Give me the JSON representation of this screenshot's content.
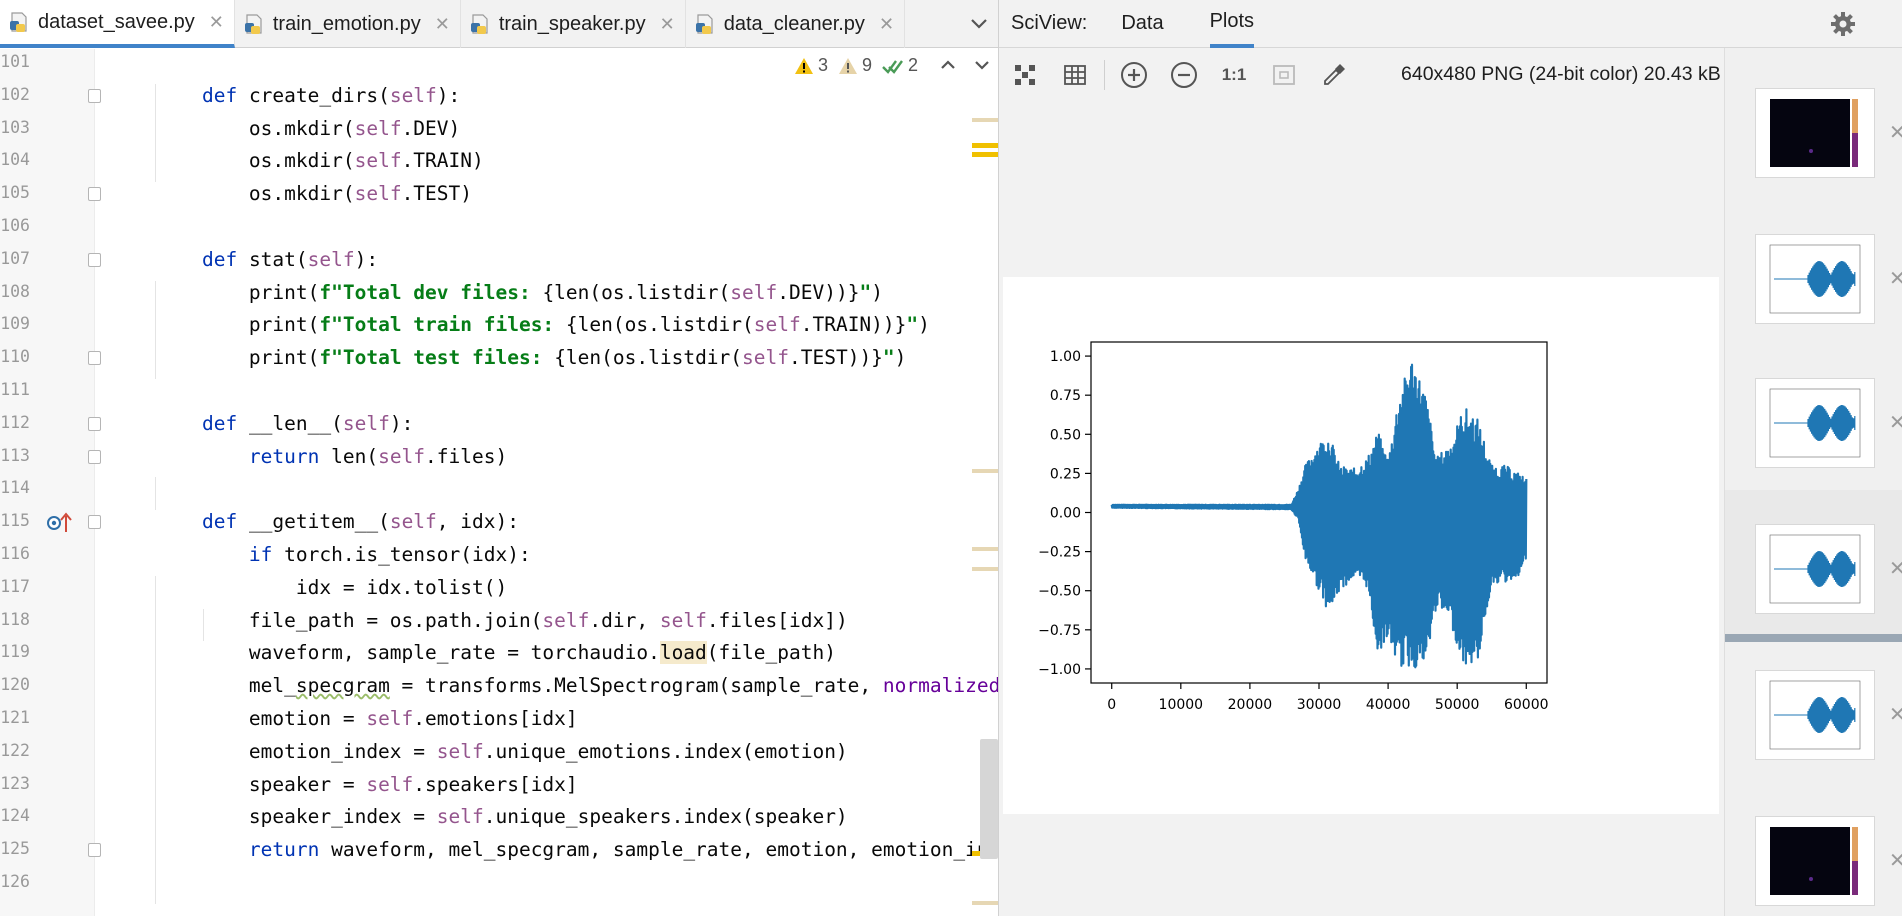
{
  "tabs": [
    {
      "label": "dataset_savee.py",
      "active": true
    },
    {
      "label": "train_emotion.py",
      "active": false
    },
    {
      "label": "train_speaker.py",
      "active": false
    },
    {
      "label": "data_cleaner.py",
      "active": false
    }
  ],
  "inspections": {
    "errors": "3",
    "warnings": "9",
    "typos": "2"
  },
  "code": [
    {
      "n": "101",
      "html": ""
    },
    {
      "n": "102",
      "html": "    <span class='kw'>def</span> create_dirs(<span class='slf'>self</span>):"
    },
    {
      "n": "103",
      "html": "        os.mkdir(<span class='slf'>self</span>.DEV)"
    },
    {
      "n": "104",
      "html": "        os.mkdir(<span class='slf'>self</span>.TRAIN)"
    },
    {
      "n": "105",
      "html": "        os.mkdir(<span class='slf'>self</span>.TEST)"
    },
    {
      "n": "106",
      "html": ""
    },
    {
      "n": "107",
      "html": "    <span class='kw'>def</span> stat(<span class='slf'>self</span>):"
    },
    {
      "n": "108",
      "html": "        print(<span class='str'>f\"Total dev files: </span>{len(os.listdir(<span class='slf'>self</span>.DEV))}<span class='str'>\"</span>)"
    },
    {
      "n": "109",
      "html": "        print(<span class='str'>f\"Total train files: </span>{len(os.listdir(<span class='slf'>self</span>.TRAIN))}<span class='str'>\"</span>)"
    },
    {
      "n": "110",
      "html": "        print(<span class='str'>f\"Total test files: </span>{len(os.listdir(<span class='slf'>self</span>.TEST))}<span class='str'>\"</span>)"
    },
    {
      "n": "111",
      "html": ""
    },
    {
      "n": "112",
      "html": "    <span class='kw'>def</span> __len__(<span class='slf'>self</span>):"
    },
    {
      "n": "113",
      "html": "        <span class='kw'>return</span> len(<span class='slf'>self</span>.files)"
    },
    {
      "n": "114",
      "html": ""
    },
    {
      "n": "115",
      "html": "    <span class='kw'>def</span> __getitem__(<span class='slf'>self</span>, idx):"
    },
    {
      "n": "116",
      "html": "        <span class='kw'>if</span> torch.is_tensor(idx):"
    },
    {
      "n": "117",
      "html": "            idx = idx.tolist()"
    },
    {
      "n": "118",
      "html": "        file_path = os.path.join(<span class='slf'>self</span>.dir, <span class='slf'>self</span>.files[idx])"
    },
    {
      "n": "119",
      "html": "        waveform, sample_rate = torchaudio.<span class='hl'>load</span>(file_path)"
    },
    {
      "n": "120",
      "html": "        mel_<span class='warn-ul'>specgram</span> = transforms.MelSpectrogram(sample_rate, <span class='param'>normalized</span>=True)"
    },
    {
      "n": "121",
      "html": "        emotion = <span class='slf'>self</span>.emotions[idx]"
    },
    {
      "n": "122",
      "html": "        emotion_index = <span class='slf'>self</span>.unique_emotions.index(emotion)"
    },
    {
      "n": "123",
      "html": "        speaker = <span class='slf'>self</span>.speakers[idx]"
    },
    {
      "n": "124",
      "html": "        speaker_index = <span class='slf'>self</span>.unique_speakers.index(speaker)"
    },
    {
      "n": "125",
      "html": "        <span class='kw'>return</span> waveform, mel_specgram, sample_rate, emotion, emotion_index"
    },
    {
      "n": "126",
      "html": ""
    }
  ],
  "sciview": {
    "title": "SciView:",
    "tabs": [
      {
        "label": "Data",
        "active": false
      },
      {
        "label": "Plots",
        "active": true
      }
    ],
    "zoom_actual": "1:1",
    "image_info": "640x480 PNG (24-bit color) 20.43 kB"
  },
  "chart_data": {
    "type": "line",
    "title": "",
    "xlabel": "",
    "ylabel": "",
    "xlim": [
      -3000,
      63000
    ],
    "ylim": [
      -1.09,
      1.09
    ],
    "xticks": [
      "0",
      "10000",
      "20000",
      "30000",
      "40000",
      "50000",
      "60000"
    ],
    "yticks": [
      "1.00",
      "0.75",
      "0.50",
      "0.25",
      "0.00",
      "−0.25",
      "−0.50",
      "−0.75",
      "−1.00"
    ],
    "series": [
      {
        "color": "#1f77b4",
        "description_points": [
          {
            "x": 0,
            "y_max": 0.05,
            "y_min": 0.03
          },
          {
            "x": 26000,
            "y_max": 0.05,
            "y_min": 0.02
          },
          {
            "x": 27000,
            "y_max": 0.15,
            "y_min": -0.05
          },
          {
            "x": 28000,
            "y_max": 0.3,
            "y_min": -0.3
          },
          {
            "x": 30000,
            "y_max": 0.45,
            "y_min": -0.5
          },
          {
            "x": 31500,
            "y_max": 0.5,
            "y_min": -0.65
          },
          {
            "x": 33000,
            "y_max": 0.3,
            "y_min": -0.5
          },
          {
            "x": 35000,
            "y_max": 0.28,
            "y_min": -0.42
          },
          {
            "x": 37000,
            "y_max": 0.35,
            "y_min": -0.48
          },
          {
            "x": 38500,
            "y_max": 0.52,
            "y_min": -0.9
          },
          {
            "x": 40000,
            "y_max": 0.35,
            "y_min": -0.8
          },
          {
            "x": 41500,
            "y_max": 0.75,
            "y_min": -0.99
          },
          {
            "x": 43500,
            "y_max": 1.0,
            "y_min": -1.0
          },
          {
            "x": 45500,
            "y_max": 0.75,
            "y_min": -0.99
          },
          {
            "x": 47000,
            "y_max": 0.35,
            "y_min": -0.6
          },
          {
            "x": 49000,
            "y_max": 0.45,
            "y_min": -0.7
          },
          {
            "x": 51000,
            "y_max": 0.68,
            "y_min": -0.99
          },
          {
            "x": 53000,
            "y_max": 0.6,
            "y_min": -0.95
          },
          {
            "x": 55000,
            "y_max": 0.3,
            "y_min": -0.45
          },
          {
            "x": 57000,
            "y_max": 0.3,
            "y_min": -0.45
          },
          {
            "x": 59000,
            "y_max": 0.25,
            "y_min": -0.4
          },
          {
            "x": 60000,
            "y_max": 0.22,
            "y_min": -0.3
          }
        ]
      }
    ]
  },
  "thumbnails": [
    {
      "kind": "spectrogram"
    },
    {
      "kind": "waveform"
    },
    {
      "kind": "waveform"
    },
    {
      "kind": "waveform"
    },
    {
      "kind": "waveform"
    },
    {
      "kind": "spectrogram"
    }
  ]
}
